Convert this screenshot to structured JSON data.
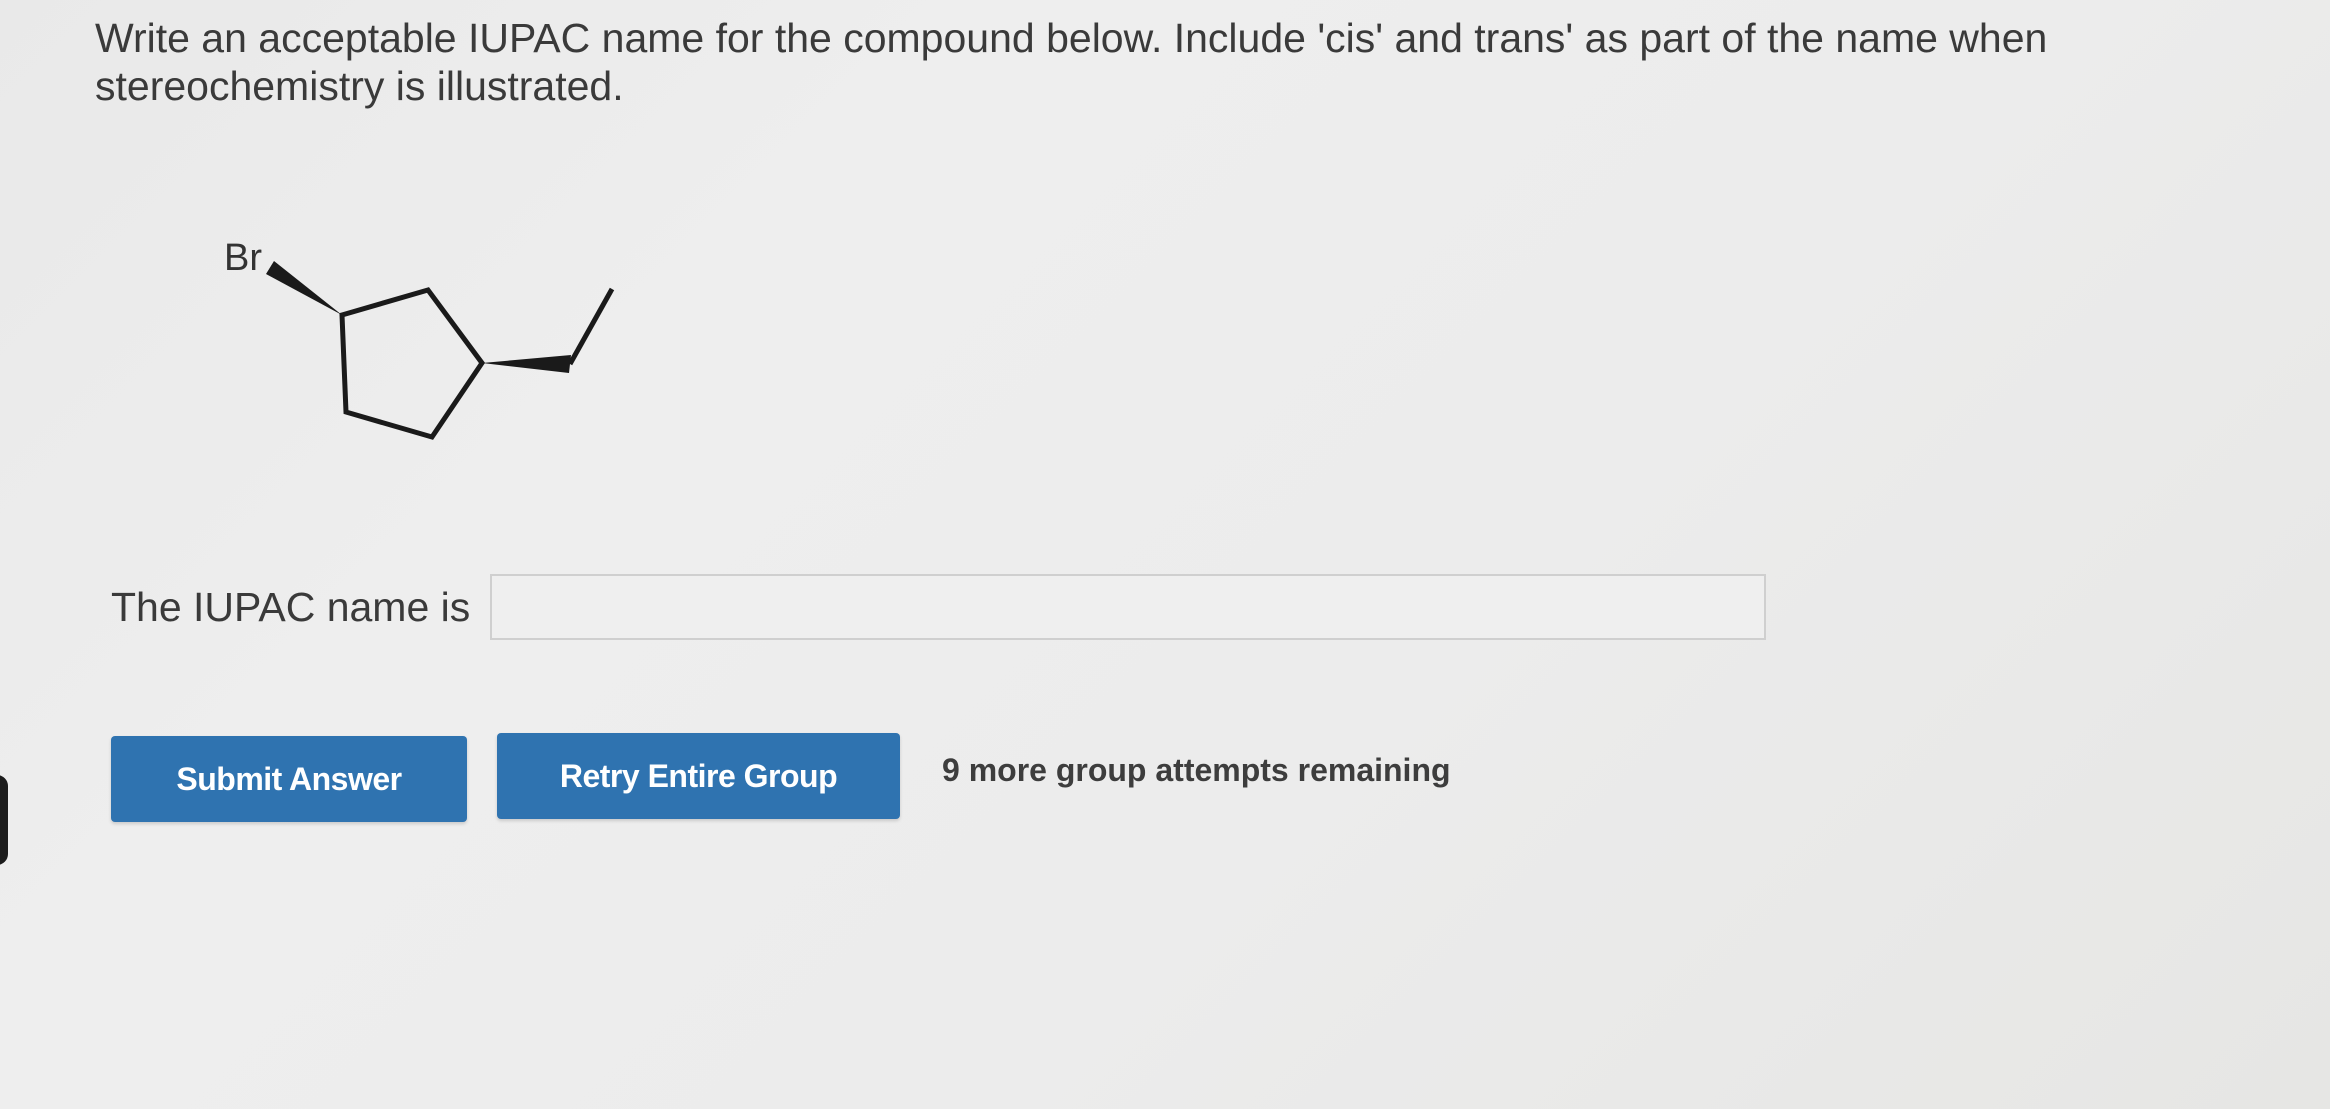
{
  "question": {
    "text": "Write an acceptable IUPAC name for the compound below. Include 'cis' and trans' as part of the name when stereochemistry is illustrated."
  },
  "structure": {
    "substituent_label": "Br"
  },
  "answer": {
    "label": "The IUPAC name is",
    "value": "",
    "placeholder": ""
  },
  "buttons": {
    "submit_label": "Submit Answer",
    "retry_label": "Retry Entire Group"
  },
  "status": {
    "attempts_text": "9 more group attempts remaining"
  },
  "colors": {
    "button_blue": "#2f73b0",
    "background": "#ebebeb"
  }
}
